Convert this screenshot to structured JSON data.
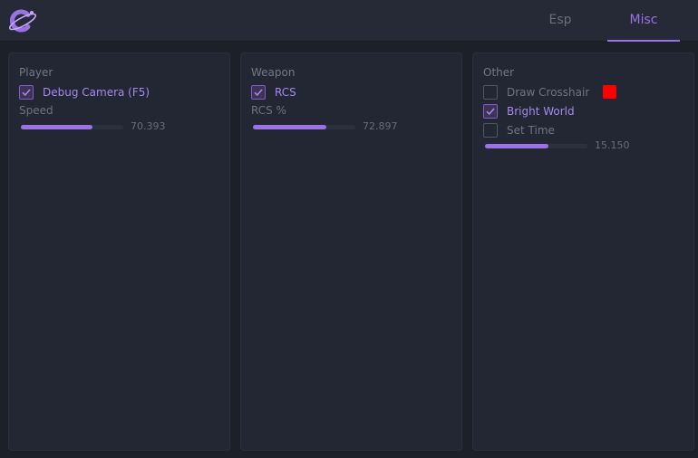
{
  "tabs": [
    {
      "label": "Esp",
      "active": false
    },
    {
      "label": "Misc",
      "active": true
    }
  ],
  "accent_color": "#9b72e3",
  "logo": {
    "icon": "planet-logo-icon"
  },
  "player": {
    "title": "Player",
    "debug_camera": {
      "label": "Debug Camera (F5)",
      "checked": true
    },
    "speed": {
      "label": "Speed",
      "value": "70.393",
      "fraction": 0.7
    }
  },
  "weapon": {
    "title": "Weapon",
    "rcs": {
      "label": "RCS",
      "checked": true
    },
    "rcs_percent": {
      "label": "RCS %",
      "value": "72.897",
      "fraction": 0.72
    }
  },
  "other": {
    "title": "Other",
    "draw_crosshair": {
      "label": "Draw Crosshair",
      "checked": false,
      "color": "#ff0000"
    },
    "bright_world": {
      "label": "Bright World",
      "checked": true
    },
    "set_time": {
      "label": "Set Time",
      "checked": false,
      "value": "15.150",
      "fraction": 0.62
    }
  }
}
